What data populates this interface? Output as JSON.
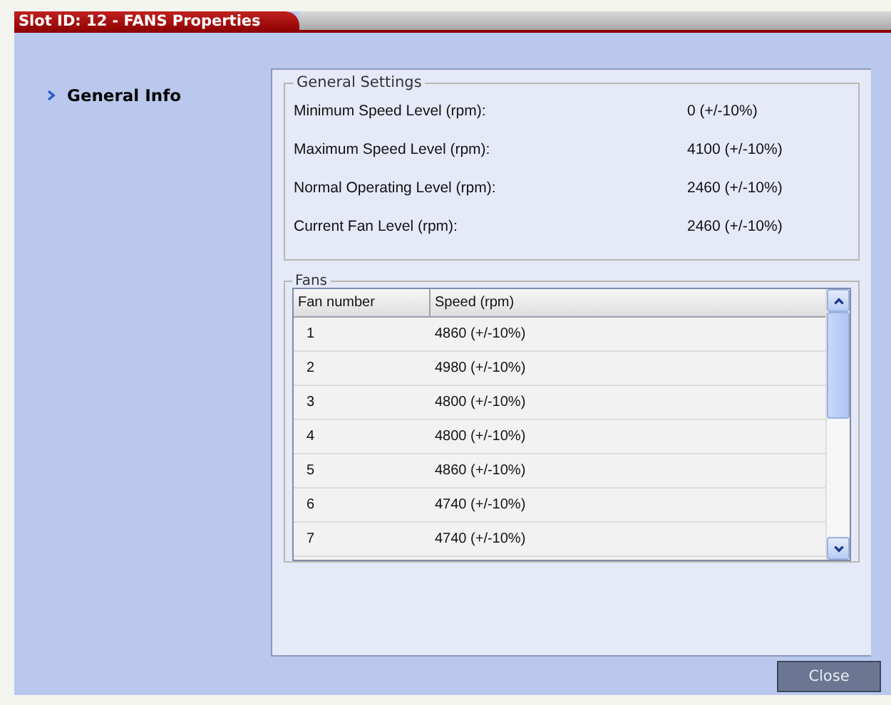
{
  "window": {
    "title": "Slot ID: 12 - FANS Properties"
  },
  "sidebar": {
    "items": [
      {
        "label": "General Info",
        "selected": true
      }
    ]
  },
  "general_settings": {
    "title": "General Settings",
    "rows": [
      {
        "label": "Minimum Speed Level (rpm):",
        "value": "0 (+/-10%)"
      },
      {
        "label": "Maximum Speed Level (rpm):",
        "value": "4100 (+/-10%)"
      },
      {
        "label": "Normal Operating Level (rpm):",
        "value": "2460 (+/-10%)"
      },
      {
        "label": "Current Fan Level (rpm):",
        "value": "2460 (+/-10%)"
      }
    ]
  },
  "fans": {
    "title": "Fans",
    "table": {
      "columns": [
        "Fan number",
        "Speed (rpm)"
      ],
      "rows": [
        [
          "1",
          "4860 (+/-10%)"
        ],
        [
          "2",
          "4980 (+/-10%)"
        ],
        [
          "3",
          "4800 (+/-10%)"
        ],
        [
          "4",
          "4800 (+/-10%)"
        ],
        [
          "5",
          "4860 (+/-10%)"
        ],
        [
          "6",
          "4740 (+/-10%)"
        ],
        [
          "7",
          "4740 (+/-10%)"
        ]
      ]
    }
  },
  "buttons": [
    "Close"
  ]
}
